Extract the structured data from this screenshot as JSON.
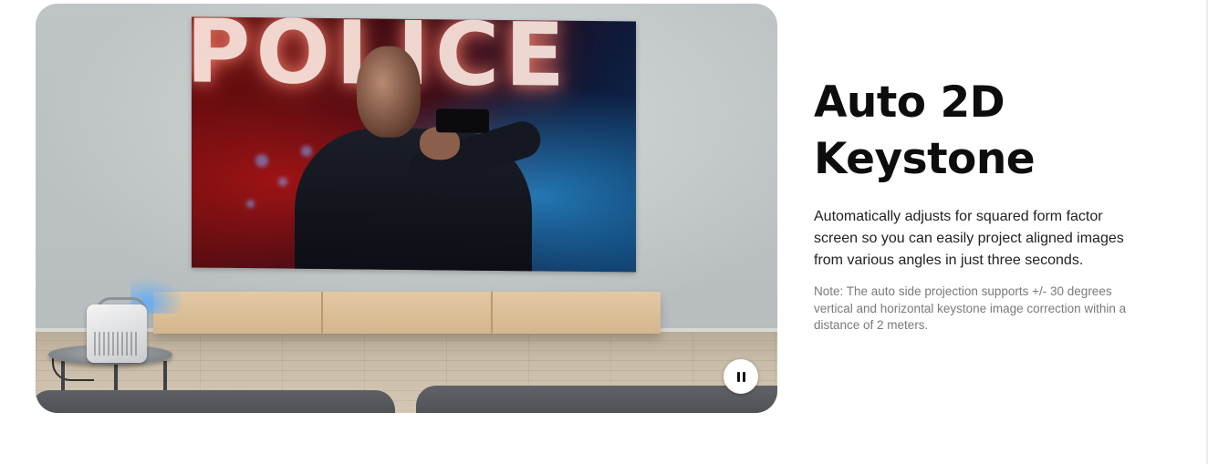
{
  "feature": {
    "headline_line1": "Auto 2D",
    "headline_line2": "Keystone",
    "description": "Automatically adjusts for squared form factor screen so you can easily project aligned images from various angles in just three seconds.",
    "note": "Note: The auto side projection supports +/- 30 degrees vertical and horizontal keystone image correction within a distance of 2 meters."
  },
  "media": {
    "screen_sign_text": "POLICE",
    "control_icon": "pause-icon"
  },
  "colors": {
    "heading": "#0d0d0d",
    "body_text": "#222222",
    "note_text": "#7a7a7a",
    "pause_button_bg": "#ffffff"
  }
}
